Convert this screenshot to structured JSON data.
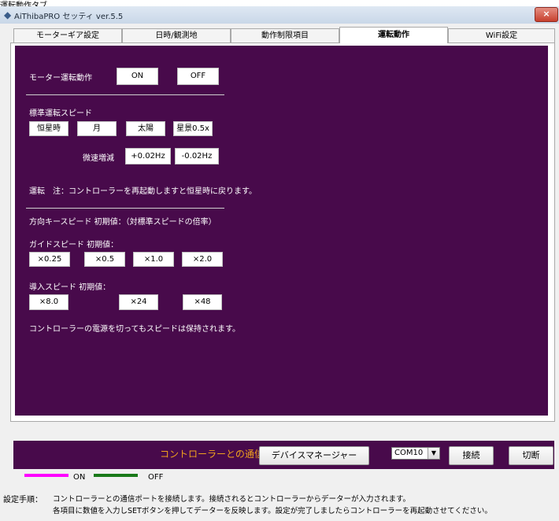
{
  "top_caption": "運転動作タブ",
  "window": {
    "title": "AiThibaPRO セッティ ver.5.5",
    "close_label": "×"
  },
  "tabs": [
    {
      "label": "モーターギア設定",
      "active": false
    },
    {
      "label": "日時/観測地",
      "active": false
    },
    {
      "label": "動作制限項目",
      "active": false
    },
    {
      "label": "運転動作",
      "active": true
    },
    {
      "label": "WiFi設定",
      "active": false
    }
  ],
  "motor": {
    "label": "モーター運転動作",
    "on": "ON",
    "off": "OFF"
  },
  "standard_speed": {
    "heading": "標準運転スピード",
    "buttons": [
      "恒星時",
      "月",
      "太陽",
      "星景0.5x"
    ],
    "fine_label": "微速増減",
    "fine_plus": "+0.02Hz",
    "fine_minus": "-0.02Hz",
    "note": "運転　注：コントローラーを再起動しますと恒星時に戻ります。"
  },
  "direction": {
    "heading": "方向キースピード 初期値：（対標準スピードの倍率）",
    "guide_label": "ガイドスピード 初期値：",
    "guide_buttons": [
      "×0.25",
      "×0.5",
      "×1.0",
      "×2.0"
    ],
    "intro_label": "導入スピード 初期値：",
    "intro_buttons": [
      "×8.0",
      "×24",
      "×48"
    ],
    "note": "コントローラーの電源を切ってもスピードは保持されます。"
  },
  "connection": {
    "label": "コントローラーとの通信",
    "device_manager": "デバイスマネージャー",
    "port": "COM10",
    "connect": "接続",
    "disconnect": "切断"
  },
  "legend": {
    "on_label": "ON",
    "off_label": "OFF",
    "on_color": "#ff00ff",
    "off_color": "#1a7a1a"
  },
  "instructions": {
    "prefix": "設定手順：",
    "line1": "コントローラーとの通信ポートを接続します。接続されるとコントローラーからデーターが入力されます。",
    "line2": "各項目に数値を入力しSETボタンを押してデーターを反映します。設定が完了しましたらコントローラーを再起動させてください。"
  }
}
